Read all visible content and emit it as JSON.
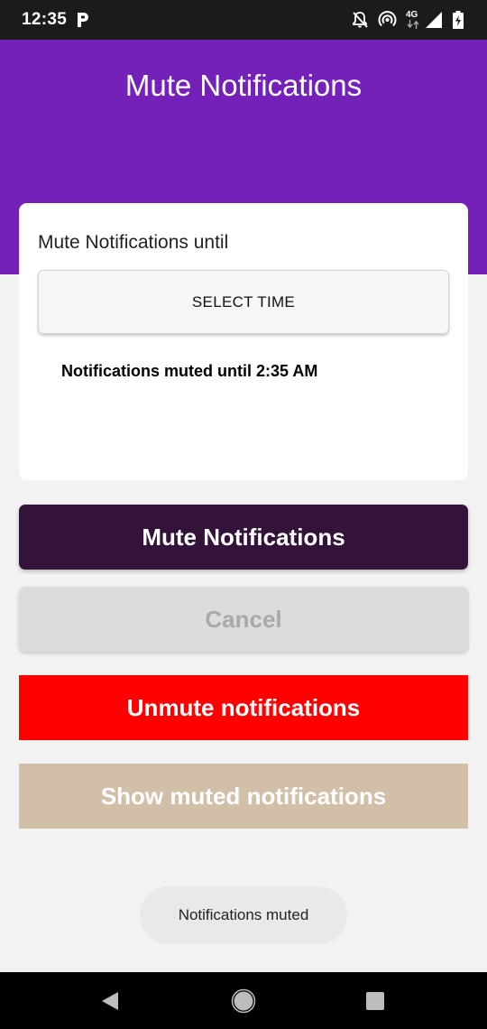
{
  "status_bar": {
    "time": "12:35",
    "network_label": "4G",
    "icons": [
      "parking-app-icon",
      "notifications-off-icon",
      "hotspot-icon",
      "data-arrows-icon",
      "signal-icon",
      "battery-charging-icon"
    ]
  },
  "header": {
    "title": "Mute Notifications",
    "color": "#7321b8"
  },
  "card": {
    "title": "Mute Notifications until",
    "select_time_label": "SELECT TIME",
    "muted_until_text": "Notifications muted until 2:35 AM"
  },
  "buttons": {
    "mute": "Mute Notifications",
    "cancel": "Cancel",
    "unmute": "Unmute notifications",
    "show_muted": "Show muted notifications"
  },
  "button_colors": {
    "mute": "#33133a",
    "cancel": "#dcdcdc",
    "unmute": "#ff0000",
    "show_muted": "#d2bfa8"
  },
  "toast": {
    "text": "Notifications muted"
  },
  "nav_bar": {
    "icons": [
      "back-icon",
      "home-icon",
      "recents-icon"
    ]
  }
}
